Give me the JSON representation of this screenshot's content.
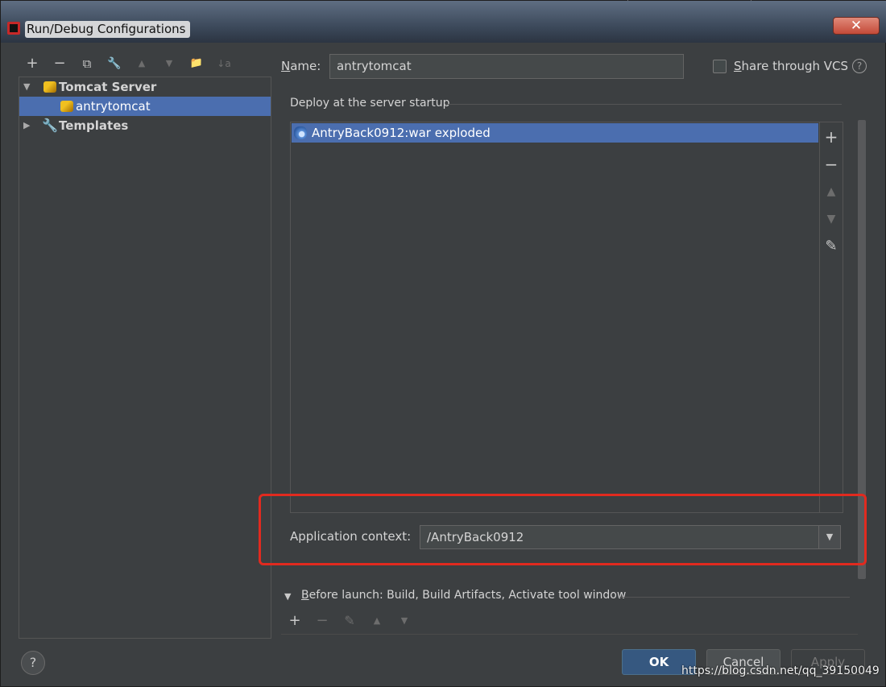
{
  "window": {
    "title": "Run/Debug Configurations",
    "close_label": "✕"
  },
  "left_toolbar": {
    "add": "+",
    "remove": "−",
    "copy": "⧉",
    "edit_defaults": "🔧",
    "move_up": "▲",
    "move_down": "▼",
    "new_folder": "📁",
    "sort": "↓a"
  },
  "tree": {
    "items": [
      {
        "label": "Tomcat Server",
        "expanded": true
      },
      {
        "label": "antrytomcat",
        "selected": true
      },
      {
        "label": "Templates",
        "expanded": false
      }
    ]
  },
  "form": {
    "name_label_prefix": "N",
    "name_label_rest": "ame:",
    "name_value": "antrytomcat",
    "share_label_prefix": "S",
    "share_label_rest": "hare through VCS",
    "share_checked": false,
    "help_glyph": "?"
  },
  "deploy": {
    "title": "Deploy at the server startup",
    "items": [
      "AntryBack0912:war exploded"
    ],
    "tools": {
      "add": "+",
      "remove": "−",
      "up": "▲",
      "down": "▼",
      "edit": "✎"
    }
  },
  "context": {
    "label": "Application context:",
    "value": "/AntryBack0912",
    "dropdown": "▼"
  },
  "before_launch": {
    "label_prefix": "B",
    "label_rest": "efore launch: Build, Build Artifacts, Activate tool window",
    "tools": {
      "add": "+",
      "remove": "−",
      "edit": "✎",
      "up": "▲",
      "down": "▼"
    }
  },
  "footer": {
    "help": "?",
    "ok": "OK",
    "cancel": "Cancel",
    "apply": "Apply",
    "watermark": "https://blog.csdn.net/qq_39150049"
  },
  "colors": {
    "selection": "#4b6eaf",
    "highlight": "#e12a1f",
    "ok_button": "#365880"
  }
}
